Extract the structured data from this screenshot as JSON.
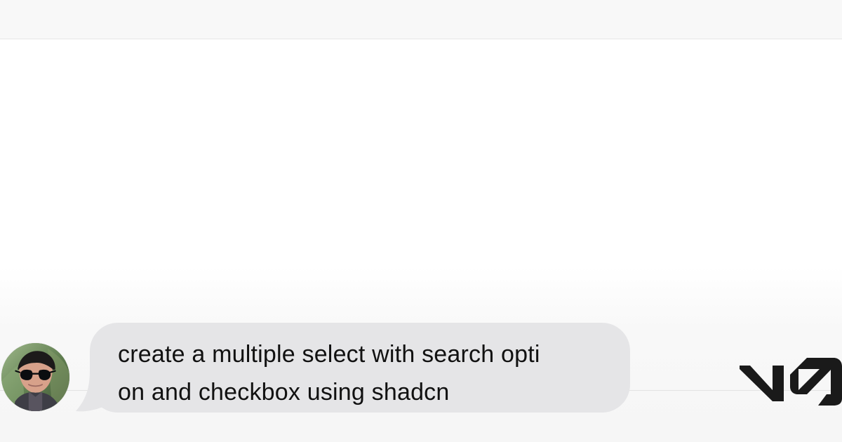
{
  "chat": {
    "message_lines": [
      "create a multiple select with search opti",
      "on and checkbox using shadcn"
    ],
    "avatar_icon": "user-avatar-icon",
    "bubble_color": "#e5e5e7"
  },
  "brand": {
    "logo_text": "V0",
    "logo_icon": "v0-logo-icon",
    "logo_color": "#1a1a1a"
  },
  "theme": {
    "background_top": "#f8f8f8",
    "background_main": "#ffffff",
    "divider_color": "#e3e3e3"
  }
}
